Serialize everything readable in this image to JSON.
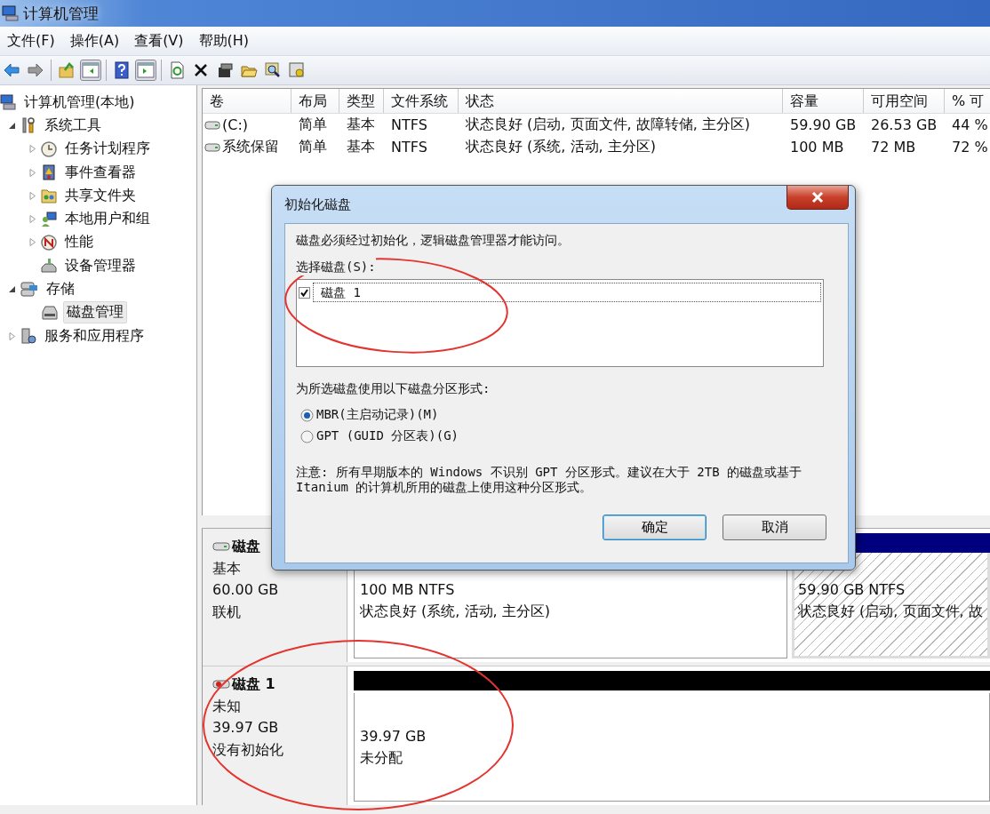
{
  "window": {
    "title": "计算机管理"
  },
  "menu": [
    "文件(F)",
    "操作(A)",
    "查看(V)",
    "帮助(H)"
  ],
  "tree": [
    {
      "label": "计算机管理(本地)",
      "selected": false,
      "children": [
        {
          "label": "系统工具",
          "selected": false,
          "expanded": true,
          "children": [
            {
              "label": "任务计划程序",
              "selected": false,
              "expanded": false
            },
            {
              "label": "事件查看器",
              "selected": false,
              "expanded": false
            },
            {
              "label": "共享文件夹",
              "selected": false,
              "expanded": false
            },
            {
              "label": "本地用户和组",
              "selected": false,
              "expanded": false
            },
            {
              "label": "性能",
              "selected": false,
              "expanded": false
            },
            {
              "label": "设备管理器",
              "selected": false
            }
          ]
        },
        {
          "label": "存储",
          "selected": false,
          "expanded": true,
          "children": [
            {
              "label": "磁盘管理",
              "selected": true
            }
          ]
        },
        {
          "label": "服务和应用程序",
          "selected": false,
          "expanded": false
        }
      ]
    }
  ],
  "volumes": {
    "columns": [
      "卷",
      "布局",
      "类型",
      "文件系统",
      "状态",
      "容量",
      "可用空间",
      "% 可"
    ],
    "rows": [
      [
        "(C:)",
        "简单",
        "基本",
        "NTFS",
        "状态良好 (启动, 页面文件, 故障转储, 主分区)",
        "59.90 GB",
        "26.53 GB",
        "44 %"
      ],
      [
        "系统保留",
        "简单",
        "基本",
        "NTFS",
        "状态良好 (系统, 活动, 主分区)",
        "100 MB",
        "72 MB",
        "72 %"
      ]
    ]
  },
  "disks": [
    {
      "name": "磁盘",
      "kind": "basic",
      "type": "基本",
      "size": "60.00 GB",
      "status": "联机",
      "partitions": [
        {
          "kind": "primary",
          "selected": false,
          "lines": [
            "100 MB NTFS",
            "状态良好 (系统, 活动, 主分区)"
          ]
        },
        {
          "kind": "primary",
          "selected": true,
          "lines": [
            "59.90 GB NTFS",
            "状态良好 (启动, 页面文件, 故"
          ]
        }
      ]
    },
    {
      "name": "磁盘 1",
      "kind": "unknown",
      "type": "未知",
      "size": "39.97 GB",
      "status": "没有初始化",
      "partitions": [
        {
          "kind": "unallocated",
          "selected": false,
          "lines": [
            "39.97 GB",
            "未分配"
          ]
        }
      ]
    }
  ],
  "dialog": {
    "title": "初始化磁盘",
    "intro": "磁盘必须经过初始化，逻辑磁盘管理器才能访问。",
    "select_label": "选择磁盘(S):",
    "disk_list": [
      {
        "label": "磁盘 1",
        "checked": true,
        "selected": true
      }
    ],
    "style_label": "为所选磁盘使用以下磁盘分区形式:",
    "options": [
      {
        "label": "MBR(主启动记录)(M)",
        "selected": true
      },
      {
        "label": "GPT (GUID 分区表)(G)",
        "selected": false
      }
    ],
    "note": "注意: 所有早期版本的 Windows 不识别 GPT 分区形式。建议在大于 2TB 的磁盘或基于 Itanium 的计算机所用的磁盘上使用这种分区形式。",
    "buttons": [
      {
        "label": "确定",
        "default": true
      },
      {
        "label": "取消",
        "default": false
      }
    ]
  }
}
